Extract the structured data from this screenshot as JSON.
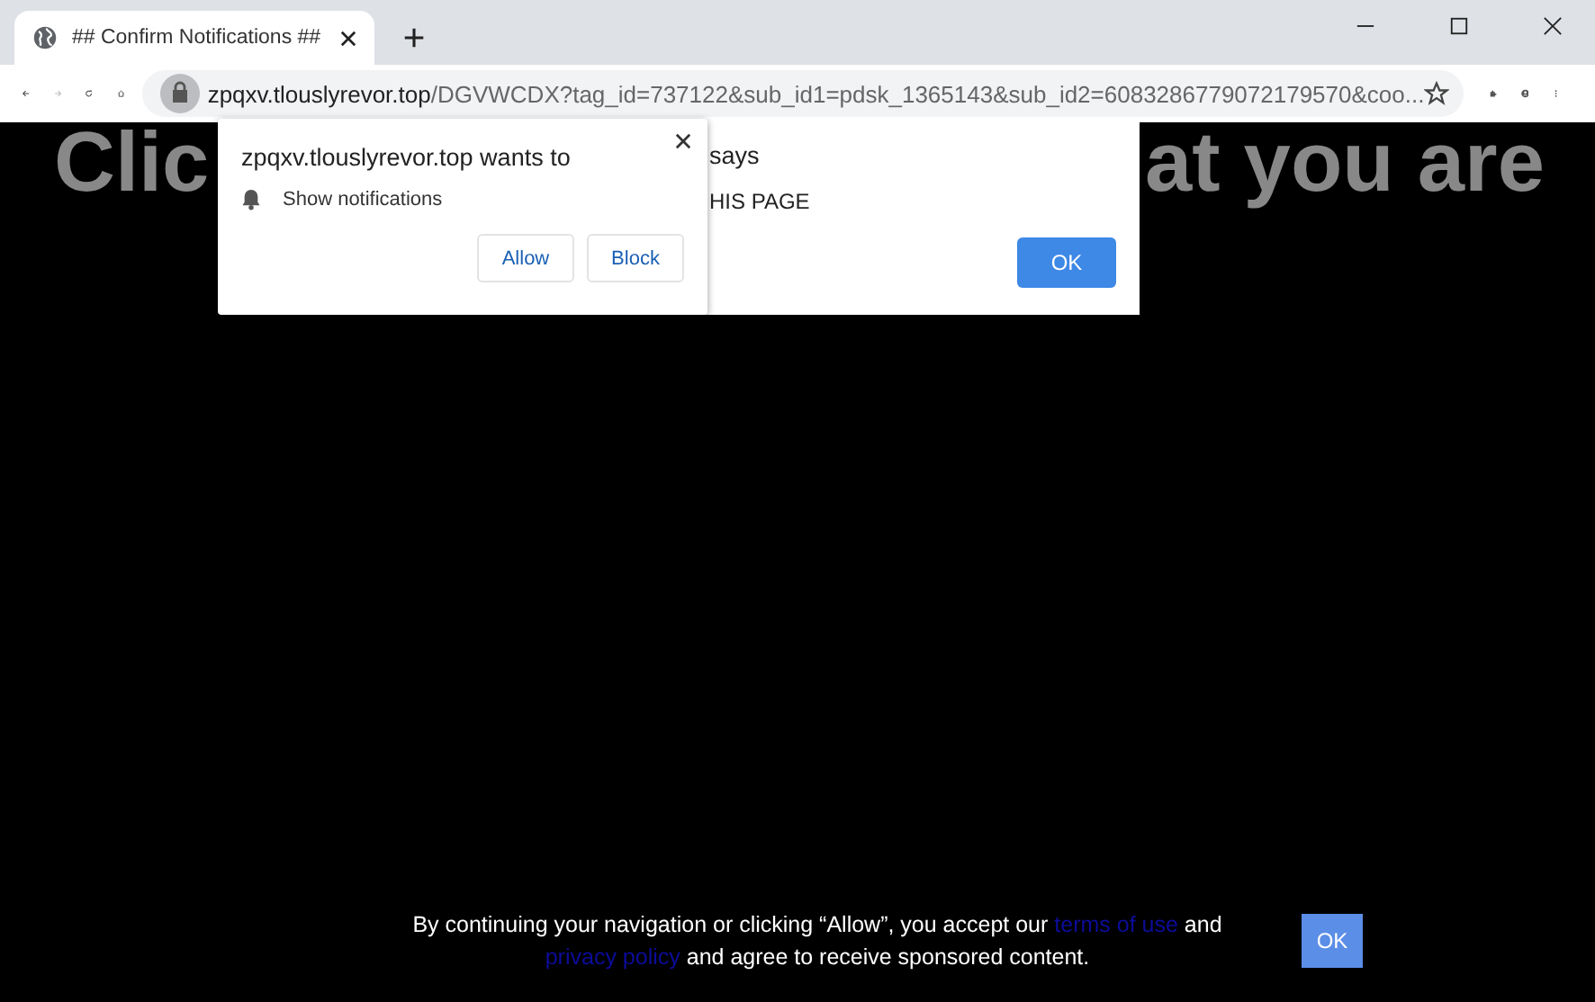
{
  "browser": {
    "tab_title": "## Confirm Notifications ##",
    "url_host": "zpqxv.tlouslyrevor.top",
    "url_path": "/DGVWCDX?tag_id=737122&sub_id1=pdsk_1365143&sub_id2=6083286779072179570&coo..."
  },
  "page": {
    "heading_parts": [
      "Clic",
      "at you are"
    ],
    "alert": {
      "lines": [
        "says",
        "HIS PAGE"
      ],
      "button": "OK"
    },
    "consent": {
      "parts": [
        {
          "kind": "text",
          "text": "By continuing your navigation or clicking “Allow”, you accept our "
        },
        {
          "kind": "link",
          "text": "terms of use"
        },
        {
          "kind": "text",
          "text": " and "
        },
        {
          "kind": "link",
          "text": "privacy policy"
        },
        {
          "kind": "text",
          "text": " and agree to receive sponsored content."
        }
      ],
      "button": "OK"
    }
  },
  "permission_prompt": {
    "title": "zpqxv.tlouslyrevor.top wants to",
    "permission": "Show notifications",
    "buttons": [
      "Allow",
      "Block"
    ]
  }
}
